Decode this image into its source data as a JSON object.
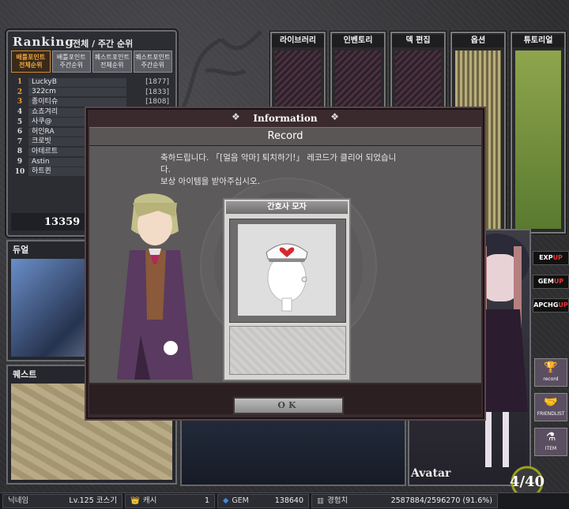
{
  "ranking": {
    "title": "Ranking",
    "subtitle": "전체 / 주간 순위",
    "tabs": [
      {
        "line1": "배틀포인트",
        "line2": "전체순위",
        "active": true
      },
      {
        "line1": "배틀포인트",
        "line2": "주간순위",
        "active": false
      },
      {
        "line1": "퀘스트포인트",
        "line2": "전체순위",
        "active": false
      },
      {
        "line1": "퀘스트포인트",
        "line2": "주간순위",
        "active": false
      }
    ],
    "rows": [
      {
        "rank": "1",
        "name": "LuckyB",
        "score": "[1877]"
      },
      {
        "rank": "2",
        "name": "322cm",
        "score": "[1833]"
      },
      {
        "rank": "3",
        "name": "종이티슈",
        "score": "[1808]"
      },
      {
        "rank": "4",
        "name": "쇼쵸겨리",
        "score": ""
      },
      {
        "rank": "5",
        "name": "사쿠@",
        "score": ""
      },
      {
        "rank": "6",
        "name": "허인RA",
        "score": ""
      },
      {
        "rank": "7",
        "name": "크로빗",
        "score": ""
      },
      {
        "rank": "8",
        "name": "아테르트",
        "score": ""
      },
      {
        "rank": "9",
        "name": "Astin",
        "score": ""
      },
      {
        "rank": "10",
        "name": "하트퀸",
        "score": ""
      }
    ],
    "my_score": "13359"
  },
  "menu": {
    "library": "라이브러리",
    "inventory": "인벤토리",
    "deck_edit": "덱 편집",
    "options": "옵션",
    "tutorial": "튜토리얼"
  },
  "panels": {
    "duel": "듀얼",
    "quest": "퀘스트",
    "avatar": "Avatar"
  },
  "side_tags": [
    {
      "text": "EXP",
      "up": "UP"
    },
    {
      "text": "GEM",
      "up": "UP"
    },
    {
      "text": "APCHG",
      "up": "UP"
    }
  ],
  "side_buttons": [
    {
      "label": "record",
      "icon": "trophy-icon"
    },
    {
      "label": "FRIENDLIST",
      "icon": "handshake-icon"
    },
    {
      "label": "ITEM",
      "icon": "potion-icon"
    }
  ],
  "gauge": {
    "current": "4",
    "max": "40",
    "text": "4/40"
  },
  "dialog": {
    "title": "Information",
    "subtitle": "Record",
    "message_line1": "축하드립니다. 「[얼음 악마] 퇴치하기!」 레코드가 클리어 되었습니",
    "message_line2": "다.",
    "message_line3": "보상 아이템을 받아주십시오.",
    "reward_name": "간호사 모자",
    "ok_label": "OK"
  },
  "status": {
    "nickname_label": "닉네임",
    "level_text": "Lv.125 코스기",
    "cash_label": "캐시",
    "cash_value": "1",
    "gem_label": "GEM",
    "gem_value": "138640",
    "exp_label": "경험치",
    "exp_value": "2587884/2596270 (91.6%)"
  }
}
